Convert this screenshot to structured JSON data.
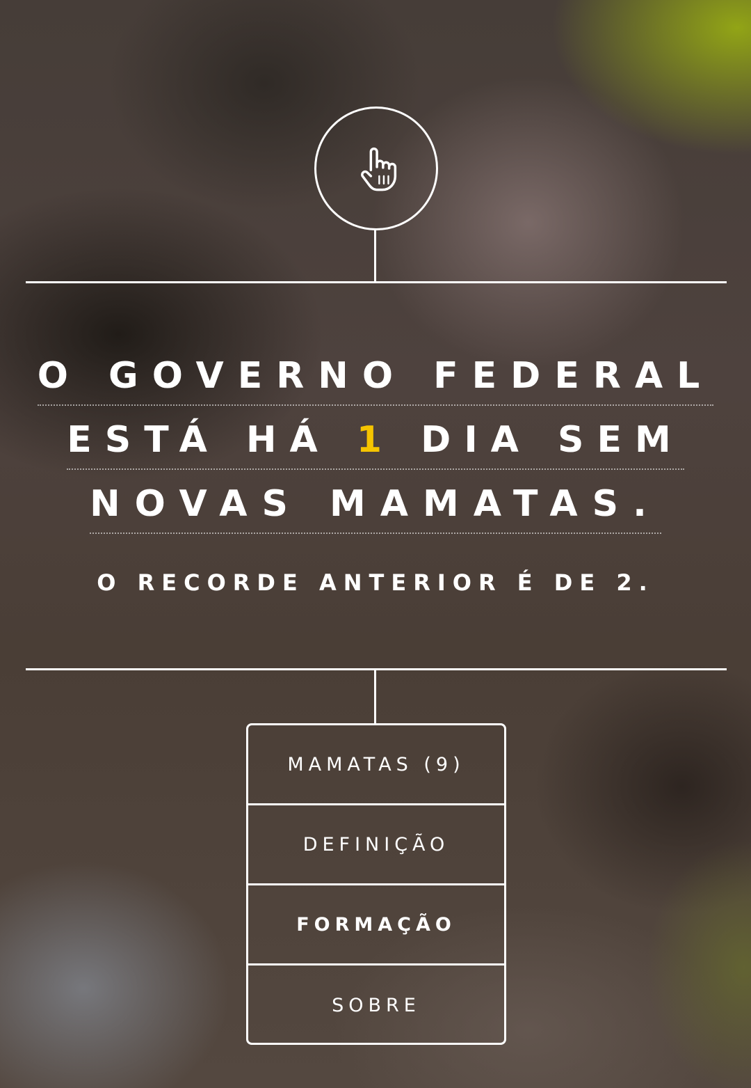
{
  "headline": {
    "line1": "O GOVERNO FEDERAL",
    "line2_before": "ESTÁ HÁ ",
    "line2_count": "1",
    "line2_after": " DIA SEM",
    "line3": "NOVAS MAMATAS."
  },
  "record_text": "O RECORDE ANTERIOR É DE 2.",
  "menu": {
    "items": [
      {
        "label": "MAMATAS (9)",
        "active": false
      },
      {
        "label": "DEFINIÇÃO",
        "active": false
      },
      {
        "label": "FORMAÇÃO",
        "active": true
      },
      {
        "label": "SOBRE",
        "active": false
      }
    ]
  },
  "colors": {
    "highlight": "#f5c400",
    "line": "#ffffff"
  },
  "icons": {
    "top": "pointing-hand-icon"
  }
}
